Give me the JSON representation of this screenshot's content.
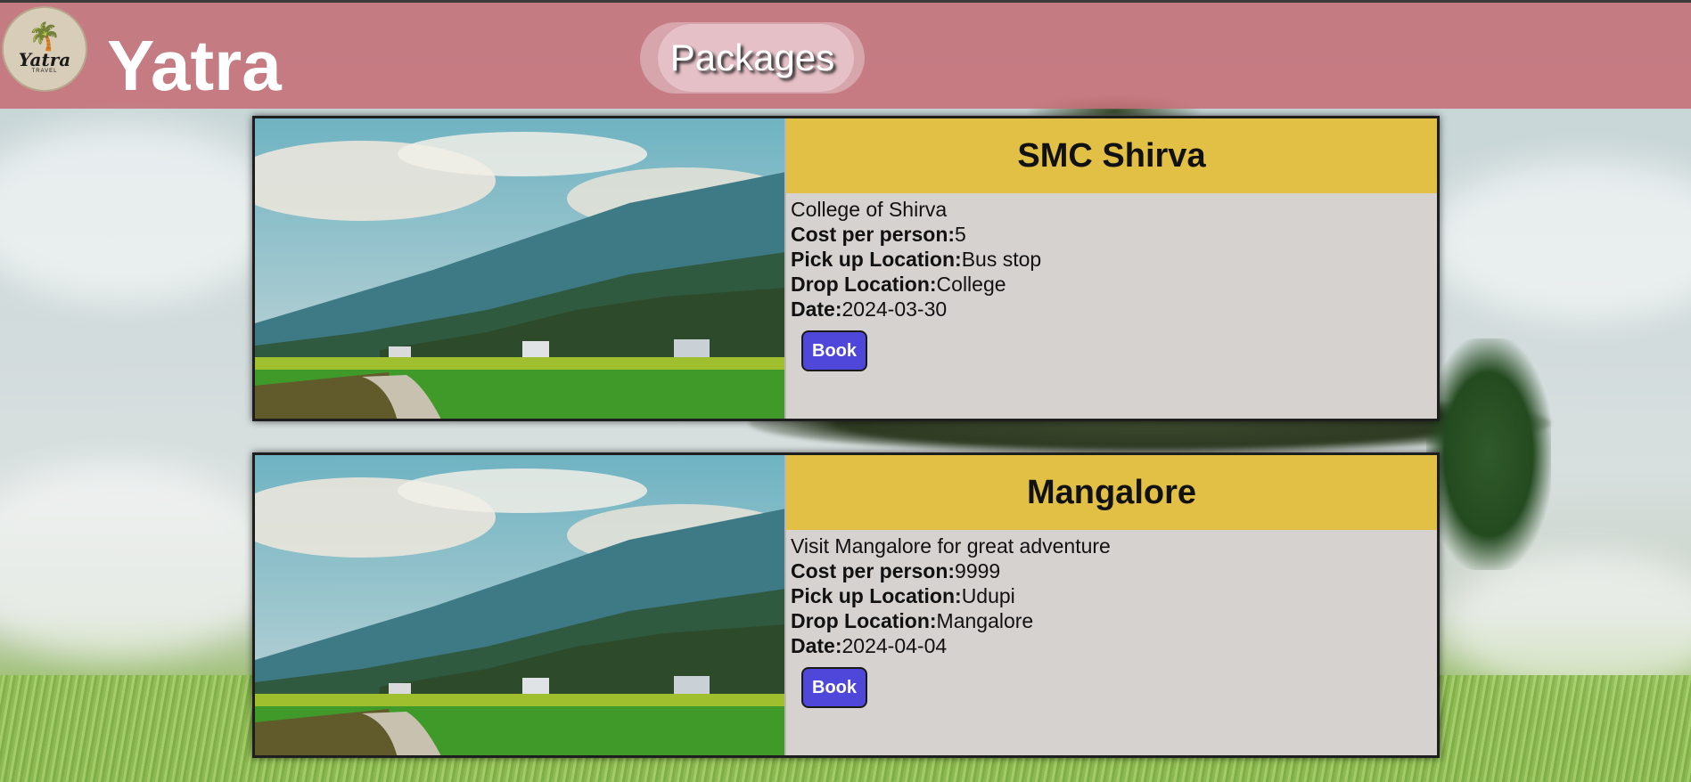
{
  "header": {
    "logo_name": "Yatra",
    "logo_subtitle": "TRAVEL",
    "brand": "Yatra",
    "nav_button": "Packages"
  },
  "packages": [
    {
      "title": "SMC Shirva",
      "description": "College of Shirva",
      "cost_label": "Cost per person:",
      "cost_value": "5",
      "pickup_label": "Pick up Location:",
      "pickup_value": "Bus stop",
      "drop_label": "Drop Location:",
      "drop_value": "College",
      "date_label": "Date:",
      "date_value": "2024-03-30",
      "button": "Book"
    },
    {
      "title": "Mangalore",
      "description": "Visit Mangalore for great adventure",
      "cost_label": "Cost per person:",
      "cost_value": "9999",
      "pickup_label": "Pick up Location:",
      "pickup_value": "Udupi",
      "drop_label": "Drop Location:",
      "drop_value": "Mangalore",
      "date_label": "Date:",
      "date_value": "2024-04-04",
      "button": "Book"
    }
  ],
  "colors": {
    "header_bg": "#c56e76",
    "title_bar": "#e2bf45",
    "card_bg": "#d5d2cf",
    "book_button": "#4f47d9"
  }
}
